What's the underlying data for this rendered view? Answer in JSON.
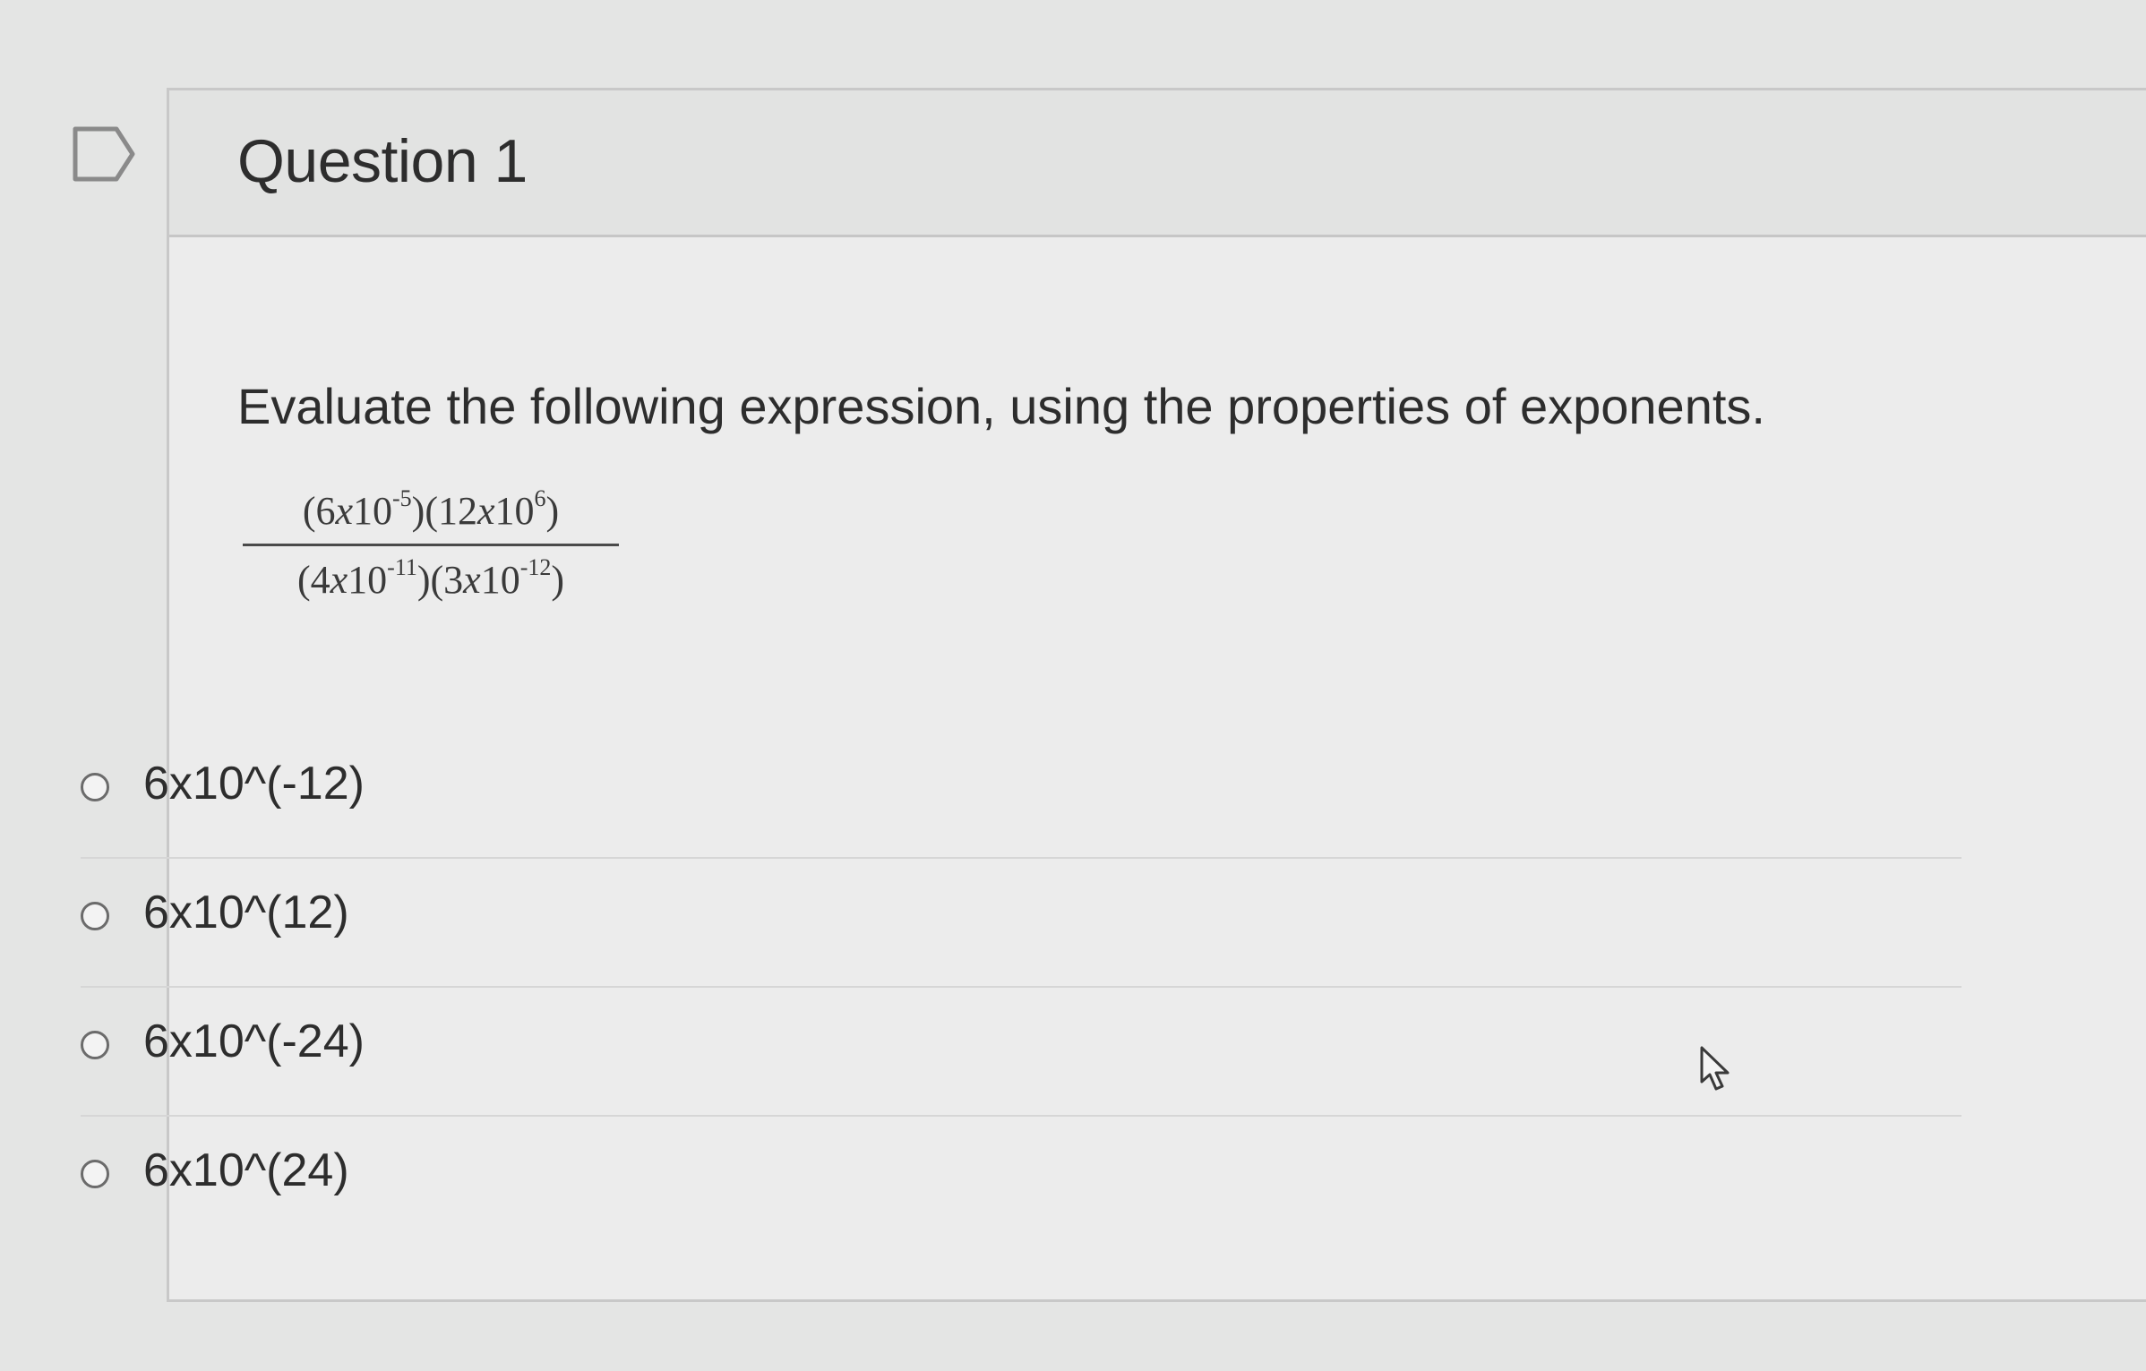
{
  "question": {
    "title": "Question 1",
    "prompt": "Evaluate the following expression, using the properties of exponents.",
    "expression": {
      "numerator": {
        "left_coef": "6",
        "left_var": "x",
        "left_base": "10",
        "left_exp": "-5",
        "right_coef": "12",
        "right_var": "x",
        "right_base": "10",
        "right_exp": "6"
      },
      "denominator": {
        "left_coef": "4",
        "left_var": "x",
        "left_base": "10",
        "left_exp": "-11",
        "right_coef": "3",
        "right_var": "x",
        "right_base": "10",
        "right_exp": "-12"
      }
    }
  },
  "options": [
    {
      "label": "6x10^(-12)"
    },
    {
      "label": "6x10^(12)"
    },
    {
      "label": "6x10^(-24)"
    },
    {
      "label": "6x10^(24)"
    }
  ],
  "icons": {
    "flag": "bookmark-flag-icon",
    "cursor": "mouse-pointer-icon"
  },
  "colors": {
    "background": "#e4e5e4",
    "text": "#2d2d2d",
    "border": "#c8c8c8"
  }
}
